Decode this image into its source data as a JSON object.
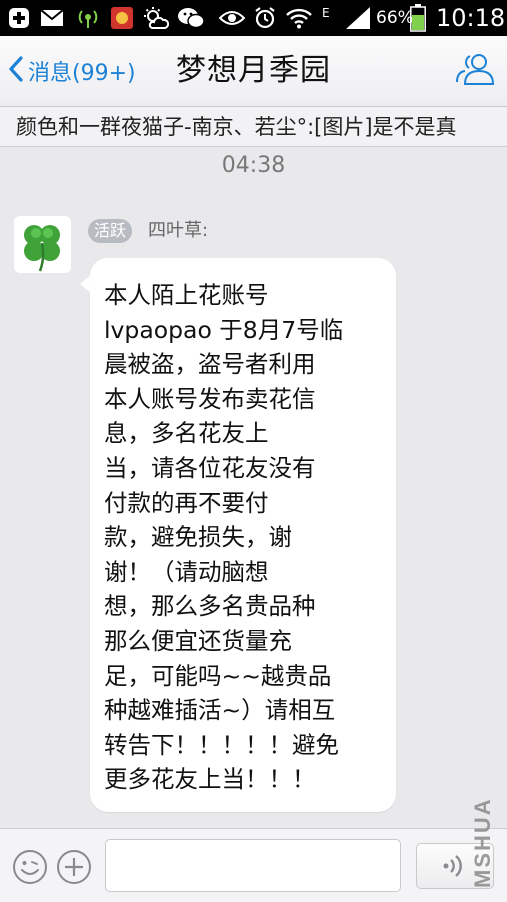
{
  "status_bar": {
    "icons": [
      "add-icon",
      "mail-icon",
      "wifi-hotspot-icon",
      "app-notification-icon",
      "weather-icon",
      "wechat-icon",
      "eye-icon",
      "alarm-icon",
      "wifi-icon",
      "signal-icon",
      "battery-icon"
    ],
    "network_type": "E",
    "battery": "66%",
    "time": "10:18"
  },
  "header": {
    "back_label": "消息(99+)",
    "title": "梦想月季园"
  },
  "preview": {
    "text": "颜色和一群夜猫子-南京、若尘°:[图片]是不是真"
  },
  "chat": {
    "timestamp": "04:38",
    "message": {
      "badge": "活跃",
      "sender": "四叶草:",
      "lines": [
        "本人陌上花账号",
        "lvpaopao 于8月7号临",
        "晨被盗，盗号者利用",
        "本人账号发布卖花信",
        "息，多名花友上",
        "当，请各位花友没有",
        "付款的再不要付",
        "款，避免损失，谢",
        "谢！（请动脑想",
        "想，那么多名贵品种",
        "那么便宜还货量充",
        "足，可能吗~~越贵品",
        "种越难插活~）请相互",
        "转告下！！！！！避免",
        "更多花友上当！！！"
      ]
    }
  },
  "input_bar": {
    "value": "",
    "placeholder": ""
  },
  "watermark": "MSHUA",
  "colors": {
    "accent": "#1d82d6",
    "background": "#e9e9ec",
    "bubble": "#ffffff",
    "clover": "#3fa33a"
  }
}
